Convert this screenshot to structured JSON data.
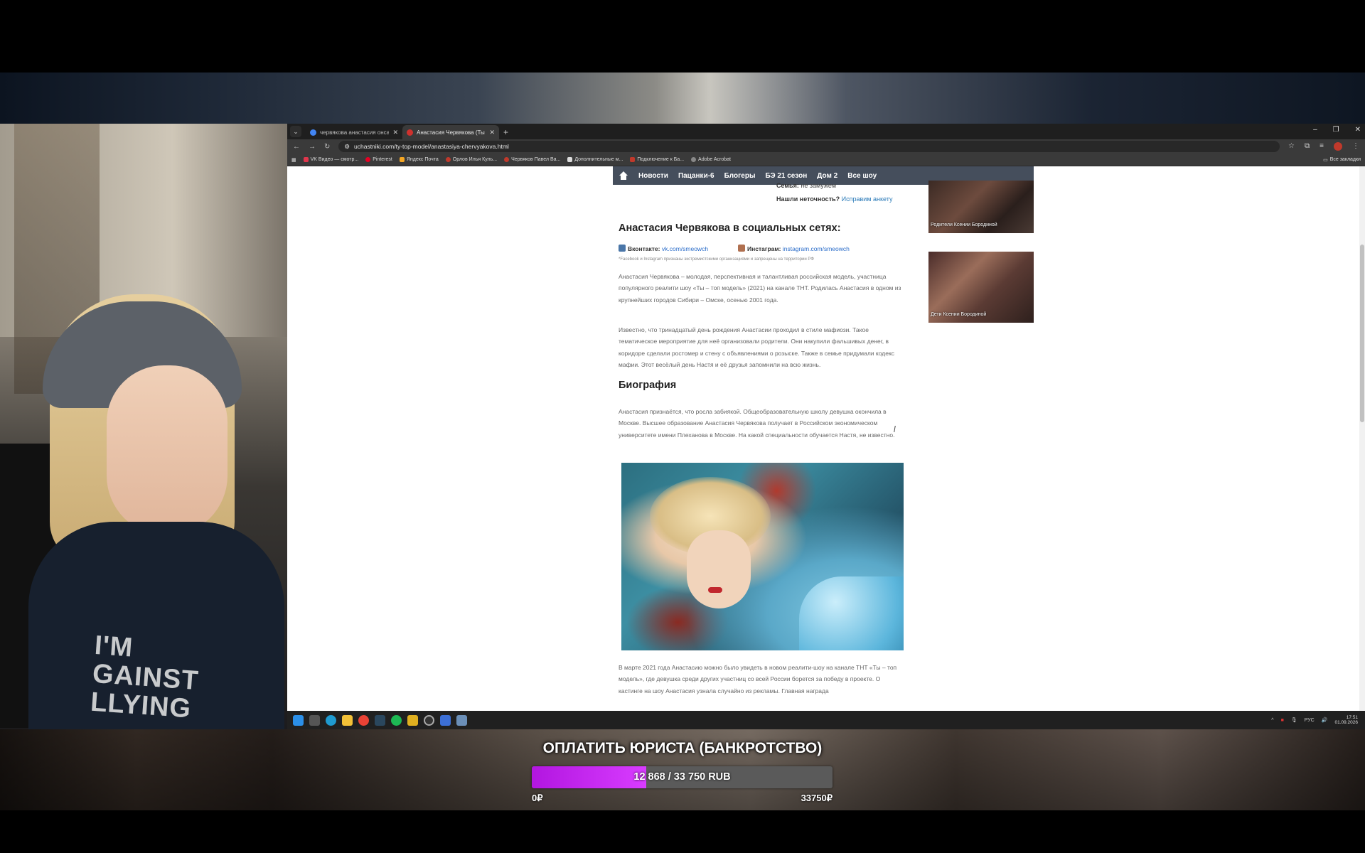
{
  "browser": {
    "tabs": [
      {
        "title": "червякова анастасия онса - П",
        "active": false
      },
      {
        "title": "Анастасия Червякова (Ты топ",
        "active": true
      }
    ],
    "new_tab": "+",
    "url": "uchastniki.com/ty-top-model/anastasiya-chervyakova.html",
    "bookmarks": [
      "VK Видео — смотр...",
      "Pinterest",
      "Яндекс Почта",
      "Орлов Илья Куль...",
      "Червяков Павел Ва...",
      "Дополнительные м...",
      "Подключение к Ба...",
      "Adobe Acrobat"
    ],
    "bookmarks_all": "Все закладки"
  },
  "site": {
    "nav": [
      "Новости",
      "Пацанки-6",
      "Блогеры",
      "БЭ 21 сезон",
      "Дом 2",
      "Все шоу"
    ]
  },
  "article": {
    "family_label": "Семья:",
    "family_value": "не замужем",
    "inaccuracy_q": "Нашли неточность?",
    "inaccuracy_link": "Исправим анкету",
    "social_heading": "Анастасия Червякова в социальных сетях:",
    "vk_label": "Вконтакте:",
    "vk_link": "vk.com/smeowch",
    "ig_label": "Инстаграм:",
    "ig_link": "instagram.com/smeowch",
    "notice": "*Facebook и Instagram признаны экстремистскими организациями и запрещены на территории РФ",
    "p1": "Анастасия Червякова – молодая, перспективная и талантливая российская модель, участница популярного реалити шоу «Ты – топ модель» (2021) на канале ТНТ. Родилась Анастасия в одном из крупнейших городов Сибири – Омске, осенью 2001 года.",
    "p2": "Известно, что тринадцатый день рождения Анастасии проходил в стиле мафиози. Такое тематическое мероприятие для неё организовали родители. Они накупили фальшивых денег, в коридоре сделали ростомер и стену с объявлениями о розыске. Также в семье придумали кодекс мафии. Этот весёлый день Настя и её друзья запомнили на всю жизнь.",
    "bio_heading": "Биография",
    "p3": "Анастасия признаётся, что росла забиякой. Общеобразовательную школу девушка окончила в Москве. Высшее образование Анастасия Червякова получает в Российском экономическом университете имени Плеханова в Москве. На какой специальности обучается Настя, не известно.",
    "p4": "В марте 2021 года Анастасию можно было увидеть в новом реалити-шоу на канале ТНТ «Ты – топ модель», где девушка среди других участниц со всей России борется за победу в проекте. О кастинге на шоу Анастасия узнала случайно из рекламы. Главная награда"
  },
  "sidebar": {
    "card1_caption": "Родители Ксении Бородиной",
    "card2_caption": "Дети Ксении Бородиной"
  },
  "taskbar": {
    "lang": "РУС",
    "time": "17:51",
    "date": "01.09.2026"
  },
  "goal": {
    "title": "ОПЛАТИТЬ ЮРИСТА (БАНКРОТСТВО)",
    "progress_text": "12 868 / 33 750 RUB",
    "current": 12868,
    "target": 33750,
    "fraction": 0.381,
    "min_label": "0₽",
    "max_label": "33750₽",
    "fill_color": "#c22cf0"
  },
  "webcam": {
    "shirt_text": "I'M\nGAINST\nLLYING"
  }
}
